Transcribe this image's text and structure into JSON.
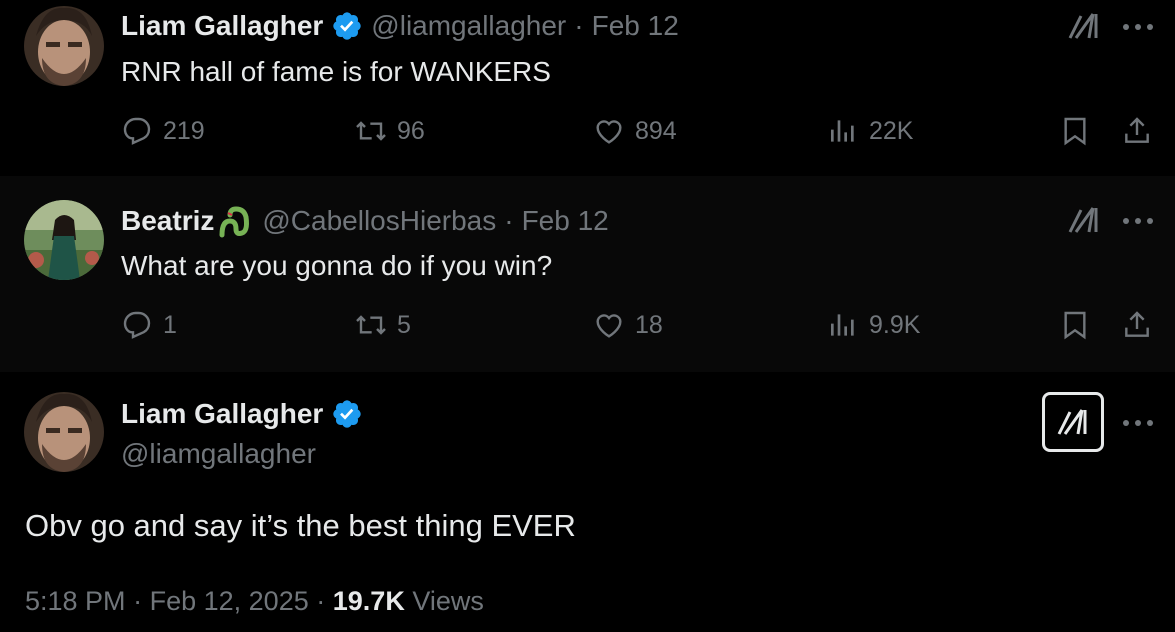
{
  "thread": [
    {
      "author_name": "Liam Gallagher",
      "handle": "@liamgallagher",
      "separator": "·",
      "date": "Feb 12",
      "text": "RNR hall of fame is for WANKERS",
      "verified": true,
      "stats": {
        "replies": "219",
        "reposts": "96",
        "likes": "894",
        "views": "22K"
      }
    },
    {
      "author_name": "Beatriz",
      "handle": "@CabellosHierbas",
      "separator": "·",
      "date": "Feb 12",
      "text": "What are you gonna do if you win?",
      "name_emoji": "snake",
      "stats": {
        "replies": "1",
        "reposts": "5",
        "likes": "18",
        "views": "9.9K"
      }
    }
  ],
  "main_tweet": {
    "author_name": "Liam Gallagher",
    "handle": "@liamgallagher",
    "verified": true,
    "text": "Obv go and say it’s the best thing EVER",
    "time": "5:18 PM",
    "separator1": "·",
    "date": "Feb 12, 2025",
    "separator2": "·",
    "views_count": "19.7K",
    "views_label": "Views"
  },
  "colors": {
    "background": "#000000",
    "text": "#e7e9ea",
    "secondary_text": "#71767b",
    "verified_blue": "#1d9bf0",
    "thread_line": "#333639"
  },
  "icons": [
    "reply-icon",
    "repost-icon",
    "like-icon",
    "views-icon",
    "bookmark-icon",
    "share-icon",
    "grok-icon",
    "more-icon",
    "verified-badge-icon",
    "snake-emoji-icon"
  ]
}
